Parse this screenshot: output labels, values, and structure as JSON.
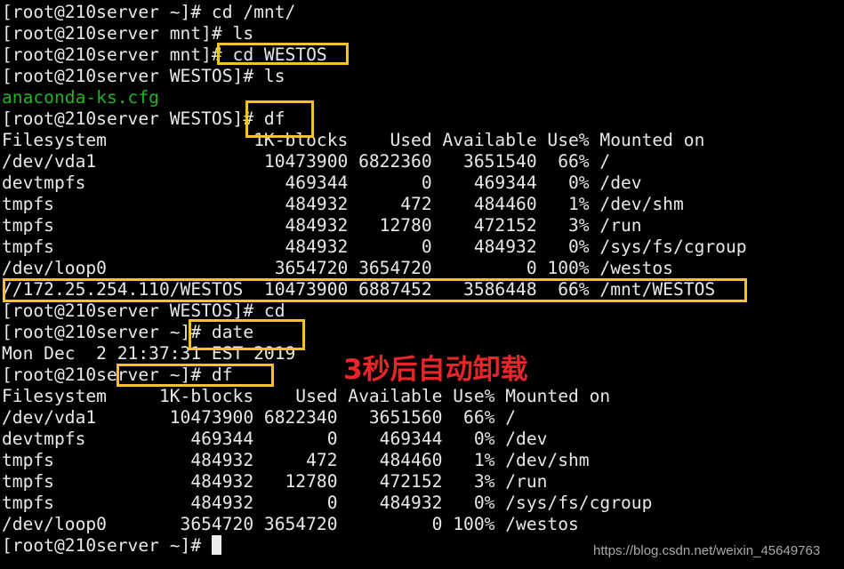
{
  "terminal": {
    "lines": [
      {
        "text": "[root@210server ~]# cd /mnt/",
        "style": "normal"
      },
      {
        "text": "[root@210server mnt]# ls",
        "style": "normal"
      },
      {
        "text": "[root@210server mnt]# cd WESTOS",
        "style": "normal"
      },
      {
        "text": "[root@210server WESTOS]# ls",
        "style": "normal"
      },
      {
        "text": "anaconda-ks.cfg",
        "style": "green"
      },
      {
        "text": "[root@210server WESTOS]# df",
        "style": "normal"
      },
      {
        "text": "Filesystem              1K-blocks    Used Available Use% Mounted on",
        "style": "normal"
      },
      {
        "text": "/dev/vda1                10473900 6822360   3651540  66% /",
        "style": "normal"
      },
      {
        "text": "devtmpfs                   469344       0    469344   0% /dev",
        "style": "normal"
      },
      {
        "text": "tmpfs                      484932     472    484460   1% /dev/shm",
        "style": "normal"
      },
      {
        "text": "tmpfs                      484932   12780    472152   3% /run",
        "style": "normal"
      },
      {
        "text": "tmpfs                      484932       0    484932   0% /sys/fs/cgroup",
        "style": "normal"
      },
      {
        "text": "/dev/loop0                3654720 3654720         0 100% /westos",
        "style": "normal"
      },
      {
        "text": "//172.25.254.110/WESTOS  10473900 6887452   3586448  66% /mnt/WESTOS",
        "style": "normal"
      },
      {
        "text": "[root@210server WESTOS]# cd",
        "style": "normal"
      },
      {
        "text": "[root@210server ~]# date",
        "style": "normal"
      },
      {
        "text": "Mon Dec  2 21:37:31 EST 2019",
        "style": "normal"
      },
      {
        "text": "[root@210server ~]# df",
        "style": "normal"
      },
      {
        "text": "Filesystem     1K-blocks    Used Available Use% Mounted on",
        "style": "normal"
      },
      {
        "text": "/dev/vda1       10473900 6822340   3651560  66% /",
        "style": "normal"
      },
      {
        "text": "devtmpfs          469344       0    469344   0% /dev",
        "style": "normal"
      },
      {
        "text": "tmpfs             484932     472    484460   1% /dev/shm",
        "style": "normal"
      },
      {
        "text": "tmpfs             484932   12780    472152   3% /run",
        "style": "normal"
      },
      {
        "text": "tmpfs             484932       0    484932   0% /sys/fs/cgroup",
        "style": "normal"
      },
      {
        "text": "/dev/loop0       3654720 3654720         0 100% /westos",
        "style": "normal"
      },
      {
        "text": "[root@210server ~]# ",
        "style": "prompt-cursor"
      }
    ]
  },
  "annotation": {
    "note": "3秒后自动卸载",
    "highlight_color": "#f6c22a",
    "note_color": "#e8262a"
  },
  "watermark": "https://blog.csdn.net/weixin_45649763"
}
